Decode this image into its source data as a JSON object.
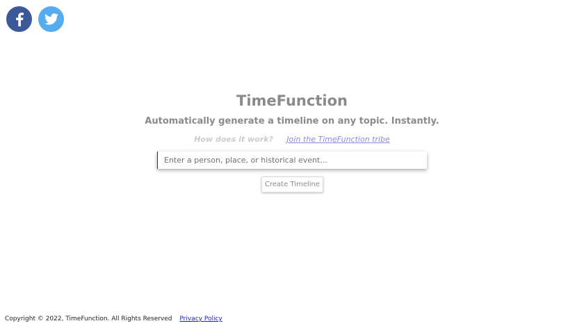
{
  "social": {
    "facebook_icon": "facebook-icon",
    "twitter_icon": "twitter-icon",
    "facebook_color": "#3b5998",
    "twitter_color": "#55acee"
  },
  "header": {
    "title": "TimeFunction",
    "subtitle": "Automatically generate a timeline on any topic. Instantly."
  },
  "links": {
    "how": "How does it work?",
    "tribe": "Join the TimeFunction tribe"
  },
  "search": {
    "placeholder": "Enter a person, place, or historical event...",
    "value": ""
  },
  "actions": {
    "create_label": "Create Timeline"
  },
  "footer": {
    "copyright": "Copyright © 2022, TimeFunction. All Rights Reserved",
    "privacy": "Privacy Policy"
  }
}
